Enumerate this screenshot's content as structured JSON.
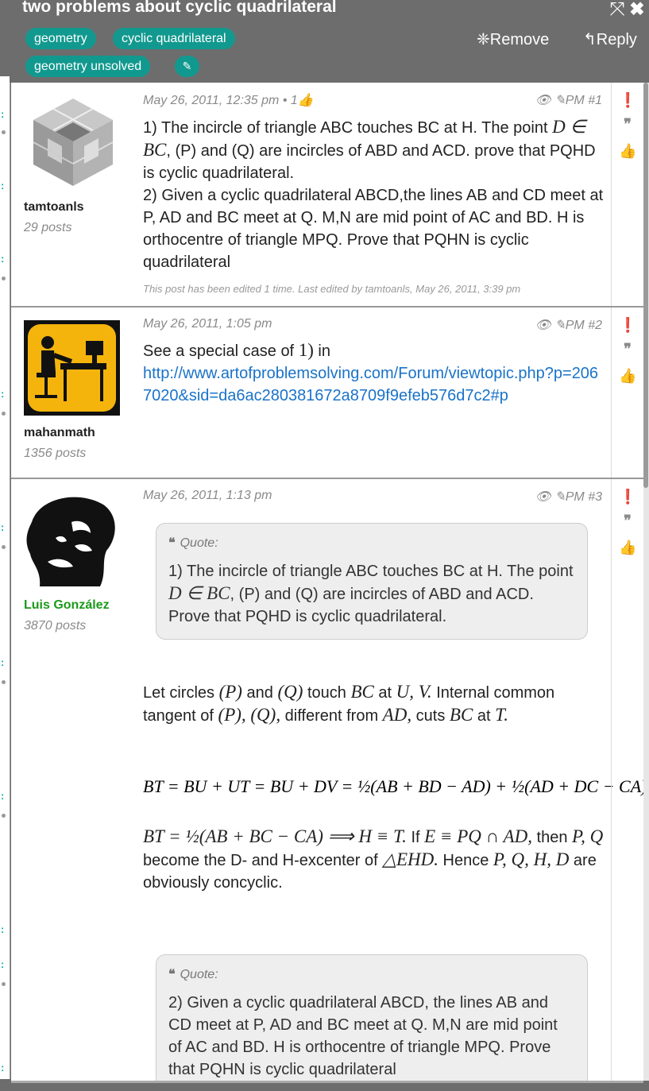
{
  "thread": {
    "title": "two problems about cyclic quadrilateral",
    "tags": [
      "geometry",
      "cyclic quadrilateral",
      "geometry unsolved"
    ],
    "remove_label": "Remove",
    "reply_label": "Reply"
  },
  "posts": [
    {
      "user": "tamtoanls",
      "post_count": "29 posts",
      "date": "May 26, 2011, 12:35 pm",
      "likes": "• 1",
      "pm": "PM",
      "num": "#1",
      "p1a": "1) The incircle of triangle ABC touches BC at H. The point",
      "p1b": "D ∈ BC",
      "p1c": ", (P) and (Q) are incircles of ABD and ACD. prove that PQHD is cyclic quadrilateral.",
      "p2": "2) Given a cyclic quadrilateral ABCD,the lines AB and CD meet at P, AD and BC meet at Q. M,N are mid point of AC and BD. H is orthocentre of triangle MPQ. Prove that PQHN is cyclic quadrilateral",
      "edited": "This post has been edited 1 time. Last edited by tamtoanls, May 26, 2011, 3:39 pm"
    },
    {
      "user": "mahanmath",
      "post_count": "1356 posts",
      "date": "May 26, 2011, 1:05 pm",
      "pm": "PM",
      "num": "#2",
      "text_a": "See a special case of",
      "text_b": "1)",
      "text_c": "in",
      "link": "http://www.artofproblemsolving.com/Forum/viewtopic.php?p=2067020&sid=da6ac280381672a8709f9efeb576d7c2#p"
    },
    {
      "user": "Luis González",
      "post_count": "3870 posts",
      "date": "May 26, 2011, 1:13 pm",
      "pm": "PM",
      "num": "#3",
      "quote_label": "Quote:",
      "quote1_a": "1) The incircle of triangle ABC touches BC at H. The point",
      "quote1_b": "D ∈ BC",
      "quote1_c": ", (P) and (Q) are incircles of ABD and ACD. Prove that PQHD is cyclic quadrilateral.",
      "s1": "Let circles",
      "m1": "(P)",
      "s2": "and",
      "m2": "(Q)",
      "s3": "touch",
      "m3": "BC",
      "s4": "at",
      "m4": "U, V.",
      "s5": "Internal common tangent of",
      "m5": "(P), (Q),",
      "s6": "different from",
      "m6": "AD,",
      "s7": "cuts",
      "m7": "BC",
      "s8": "at",
      "m8": "T.",
      "eq1": "BT = BU + UT = BU + DV = ½(AB + BD − AD) + ½(AD + DC − CA)",
      "eq2": "BT = ½(AB + BC − CA) ⟹ H ≡ T.",
      "t1": "If",
      "e1": "E ≡ PQ ∩ AD,",
      "t2": "then",
      "e2": "P, Q",
      "t3": "become the D- and H-excenter of",
      "e3": "△EHD.",
      "t4": "Hence",
      "e4": "P, Q, H, D",
      "t5": "are obviously concyclic.",
      "quote2": "2) Given a cyclic quadrilateral ABCD, the lines AB and CD meet at P, AD and BC meet at Q. M,N are mid point of AC and BD. H is orthocentre of triangle MPQ. Prove that PQHN is cyclic quadrilateral"
    }
  ],
  "colors": {
    "tag": "#12998f",
    "header": "#6d6d6d",
    "link": "#1a73c9",
    "luis": "#1a9a1a"
  }
}
